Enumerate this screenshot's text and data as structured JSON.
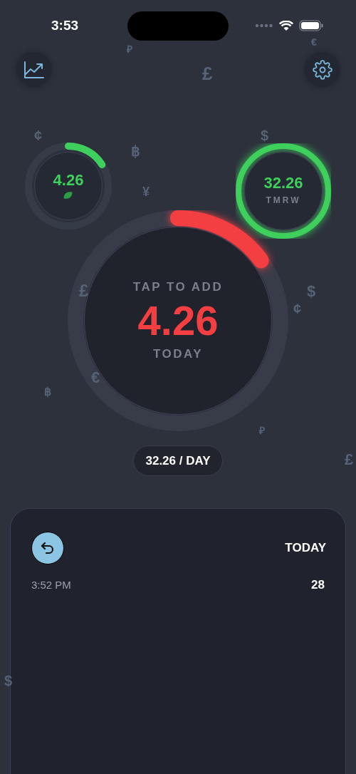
{
  "status_bar": {
    "time": "3:53"
  },
  "background_symbols": [
    "₽",
    "£",
    "€",
    "¢",
    "฿",
    "¥",
    "$",
    "£",
    "$",
    "¢",
    "€",
    "฿",
    "₽",
    "£",
    "$"
  ],
  "rings": [
    {
      "kind": "small",
      "value": "4.26",
      "level": 0.16,
      "color": "#3ecf5c"
    },
    {
      "kind": "tomorrow",
      "value": "32.26",
      "label": "TMRW",
      "level": 1,
      "color": "#3ecf5c"
    }
  ],
  "main_ring": {
    "hint": "TAP TO ADD",
    "value": "4.26",
    "label": "TODAY",
    "level": 0.15,
    "color": "#f43f42"
  },
  "daily_budget": "32.26 / DAY",
  "log": {
    "heading": "TODAY",
    "entries": [
      {
        "time": "3:52 PM",
        "amount": "28"
      }
    ]
  }
}
